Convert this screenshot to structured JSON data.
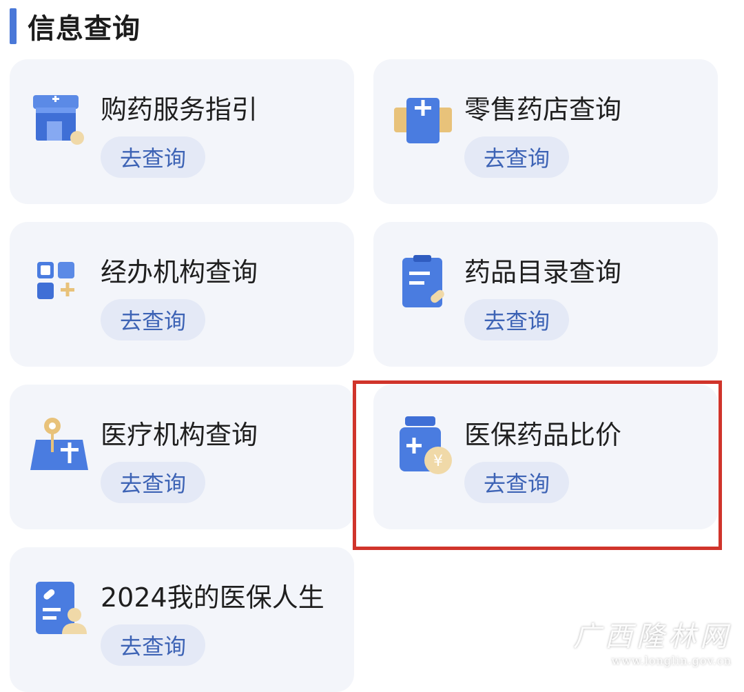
{
  "section": {
    "title": "信息查询"
  },
  "cards": [
    {
      "title": "购药服务指引",
      "button": "去查询",
      "icon": "pharmacy-store-icon"
    },
    {
      "title": "零售药店查询",
      "button": "去查询",
      "icon": "retail-pharmacy-icon"
    },
    {
      "title": "经办机构查询",
      "button": "去查询",
      "icon": "agency-grid-icon"
    },
    {
      "title": "药品目录查询",
      "button": "去查询",
      "icon": "drug-catalog-icon"
    },
    {
      "title": "医疗机构查询",
      "button": "去查询",
      "icon": "medical-institution-map-icon"
    },
    {
      "title": "医保药品比价",
      "button": "去查询",
      "icon": "drug-price-compare-icon"
    },
    {
      "title": "2024我的医保人生",
      "button": "去查询",
      "icon": "my-insurance-record-icon"
    }
  ],
  "watermark": {
    "name": "广西隆林网",
    "url": "www.longlin.gov.cn"
  },
  "colors": {
    "accent": "#4a78d8",
    "highlight": "#d0342b",
    "card_bg": "#f3f5fa",
    "button_bg": "#e4e9f6",
    "button_text": "#3d63b5"
  }
}
